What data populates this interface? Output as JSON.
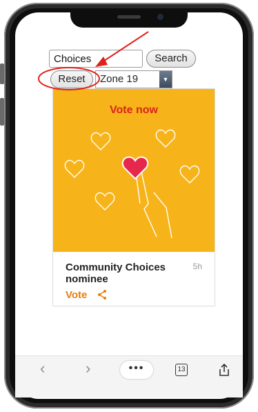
{
  "search": {
    "value": "Choices",
    "button_label": "Search"
  },
  "controls": {
    "reset_label": "Reset",
    "zone_value": "Zone 19"
  },
  "card": {
    "banner_text": "Vote now",
    "title": "Community Choices nominee",
    "time": "5h",
    "vote_label": "Vote"
  },
  "toolbar": {
    "tab_count": "13",
    "more_label": "•••"
  },
  "colors": {
    "banner": "#f7b41a",
    "banner_text": "#d9251c",
    "vote_link": "#e67e0f",
    "annotation": "#e0201a"
  },
  "icons": {
    "back": "chevron-left-icon",
    "forward": "chevron-right-icon",
    "share": "share-icon",
    "upload": "share-upload-icon"
  }
}
